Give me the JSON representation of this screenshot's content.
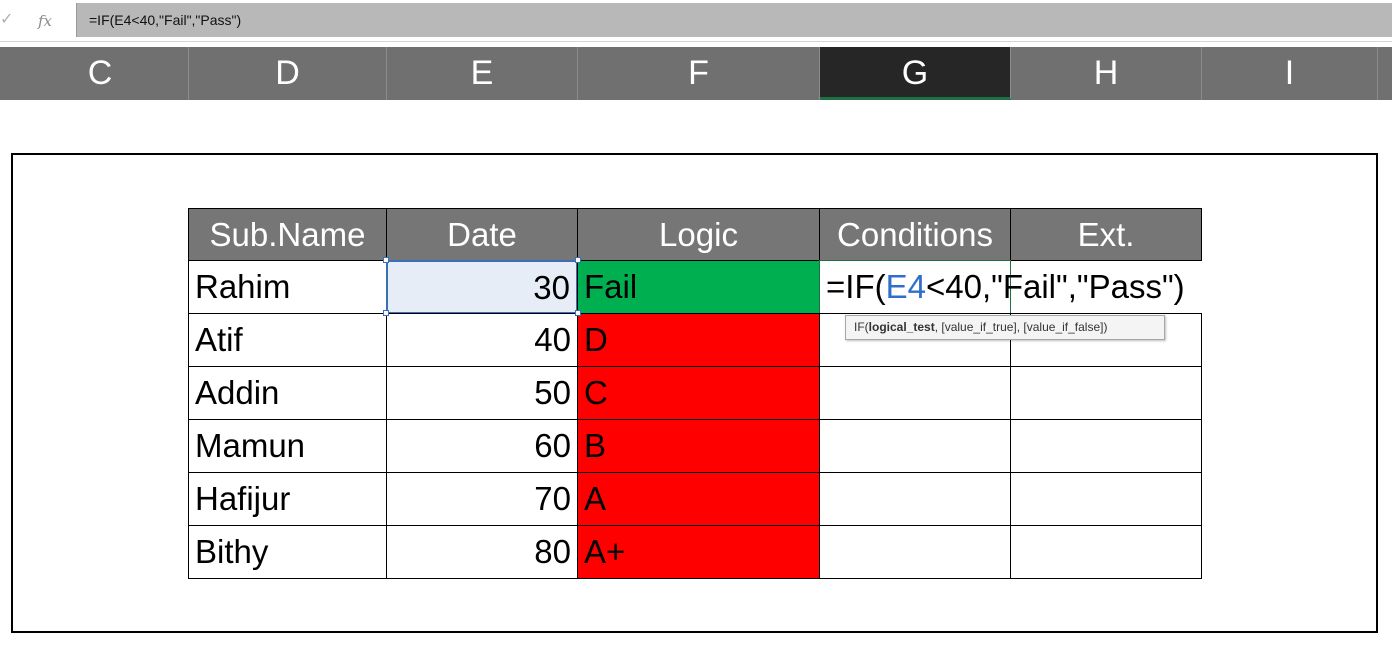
{
  "formula_bar": {
    "check_icon": "check-icon",
    "fx_label": "fx",
    "formula": "=IF(E4<40,\"Fail\",\"Pass\")"
  },
  "columns": [
    "C",
    "D",
    "E",
    "F",
    "G",
    "H",
    "I"
  ],
  "selected_column": "G",
  "table": {
    "headers": [
      "Sub.Name",
      "Date",
      "Logic",
      "Conditions",
      "Ext."
    ],
    "rows": [
      {
        "name": "Rahim",
        "date": "30",
        "logic": "Fail"
      },
      {
        "name": "Atif",
        "date": "40",
        "logic": "D"
      },
      {
        "name": "Addin",
        "date": "50",
        "logic": "C"
      },
      {
        "name": "Mamun",
        "date": "60",
        "logic": "B"
      },
      {
        "name": "Hafijur",
        "date": "70",
        "logic": "A"
      },
      {
        "name": "Bithy",
        "date": "80",
        "logic": "A+"
      }
    ]
  },
  "editing": {
    "prefix": "=IF(",
    "ref": "E4",
    "suffix": "<40,\"Fail\",\"Pass\")"
  },
  "tooltip": {
    "fn": "IF(",
    "arg_bold": "logical_test",
    "rest": ", [value_if_true], [value_if_false])"
  },
  "colors": {
    "header_fill": "#767676",
    "pass_fill": "#00b050",
    "grade_fill": "#ff0000",
    "ref_blue": "#2f6fc9"
  }
}
